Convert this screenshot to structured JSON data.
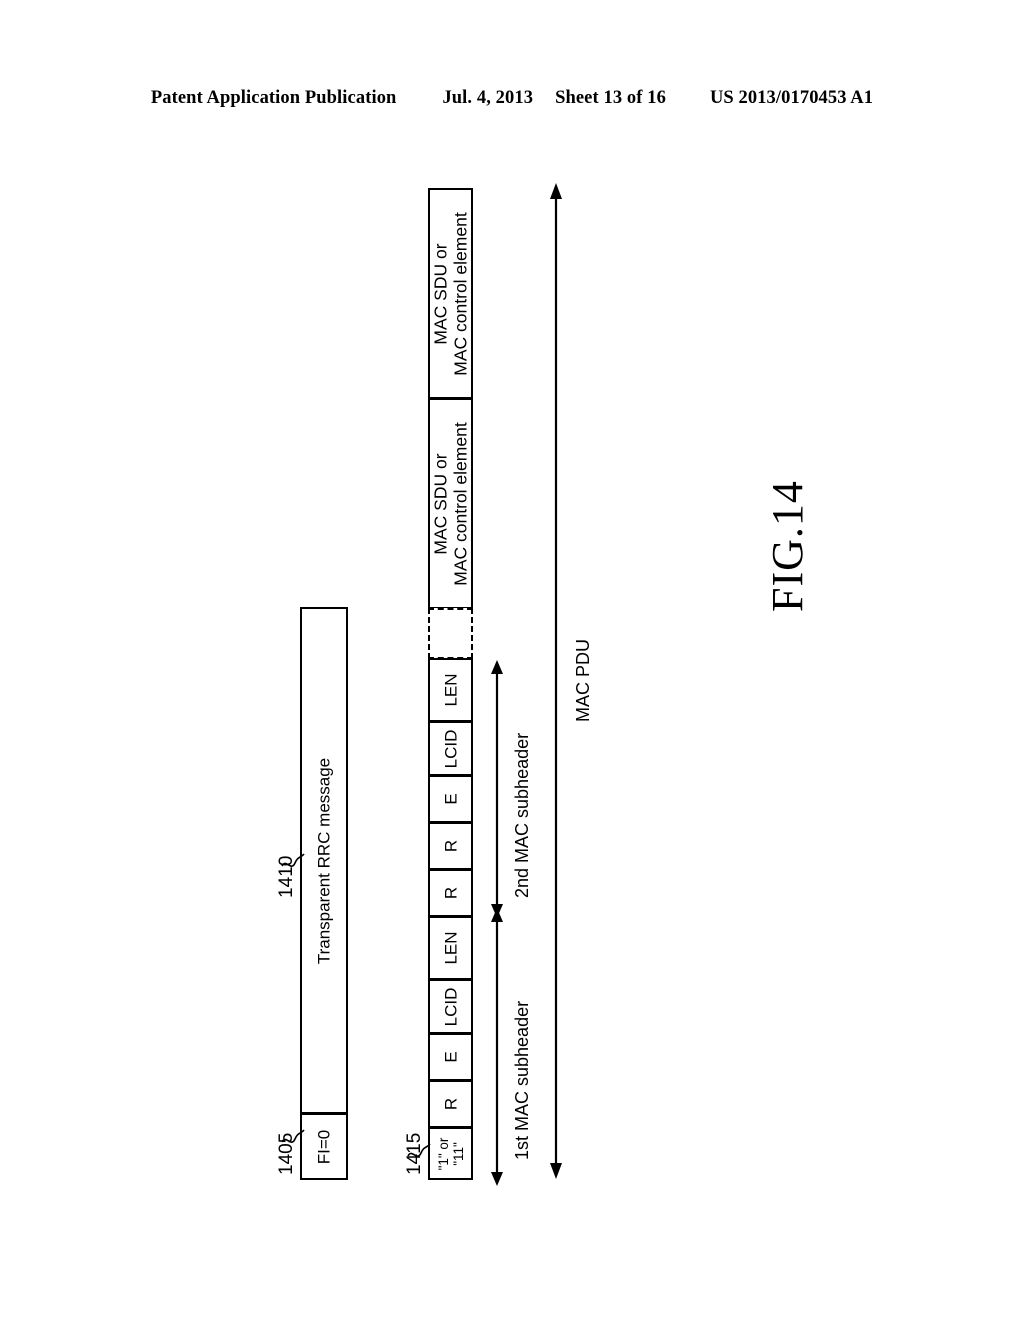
{
  "header": {
    "publication": "Patent Application Publication",
    "date": "Jul. 4, 2013",
    "sheet": "Sheet 13 of 16",
    "patent_number": "US 2013/0170453 A1"
  },
  "figure": {
    "caption": "FIG.14",
    "rlc_pdu": {
      "ref_numeral_header": "1405",
      "ref_numeral_payload": "1410",
      "header_label": "FI=0",
      "payload_label": "Transparent RRC message"
    },
    "mac_pdu": {
      "ref_numeral": "1415",
      "overall_label": "MAC PDU",
      "subheader_1_label": "1st MAC subheader",
      "subheader_2_label": "2nd MAC subheader",
      "cells": [
        {
          "id": "mac-sdu-2",
          "line1": "MAC SDU or",
          "line2": "MAC control element"
        },
        {
          "id": "mac-sdu-1",
          "line1": "MAC SDU or",
          "line2": "MAC control element"
        },
        {
          "id": "mac-gap",
          "line1": "",
          "line2": ""
        },
        {
          "id": "mac-len-2",
          "line1": "LEN",
          "line2": ""
        },
        {
          "id": "mac-lcid-2",
          "line1": "LCID",
          "line2": ""
        },
        {
          "id": "mac-e-2",
          "line1": "E",
          "line2": ""
        },
        {
          "id": "mac-r-2b",
          "line1": "R",
          "line2": ""
        },
        {
          "id": "mac-r-2a",
          "line1": "R",
          "line2": ""
        },
        {
          "id": "mac-len-1",
          "line1": "LEN",
          "line2": ""
        },
        {
          "id": "mac-lcid-1",
          "line1": "LCID",
          "line2": ""
        },
        {
          "id": "mac-e-1",
          "line1": "E",
          "line2": ""
        },
        {
          "id": "mac-r-1",
          "line1": "R",
          "line2": ""
        },
        {
          "id": "mac-fi-1",
          "line1": "\"1\" or",
          "line2": "\"11\""
        }
      ]
    }
  }
}
